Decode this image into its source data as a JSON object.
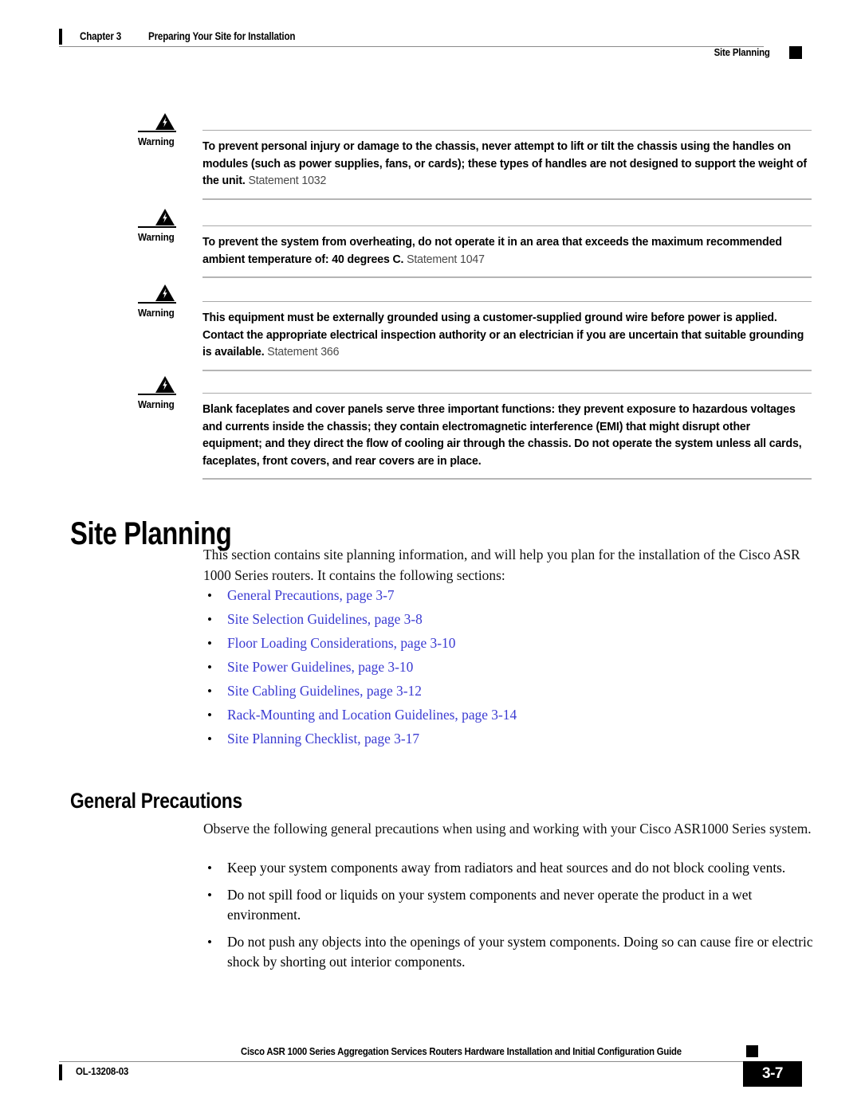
{
  "header": {
    "chapter": "Chapter 3",
    "chapter_title": "Preparing Your Site for Installation",
    "section": "Site Planning"
  },
  "warnings": [
    {
      "label": "Warning",
      "icon": "warning-triangle-lightning-icon",
      "text": "To prevent personal injury or damage to the chassis, never attempt to lift or tilt the chassis using the handles on modules (such as power supplies, fans, or cards); these types of handles are not designed to support the weight of the unit.",
      "statement": "Statement 1032"
    },
    {
      "label": "Warning",
      "icon": "warning-triangle-lightning-icon",
      "text": "To prevent the system from overheating, do not operate it in an area that exceeds the maximum recommended ambient temperature of: 40 degrees C.",
      "statement": "Statement 1047"
    },
    {
      "label": "Warning",
      "icon": "warning-triangle-lightning-icon",
      "text": "This equipment must be externally grounded using a customer-supplied ground wire before power is applied. Contact the appropriate electrical inspection authority or an electrician if you are uncertain that suitable grounding is available.",
      "statement": "Statement 366"
    },
    {
      "label": "Warning",
      "icon": "warning-triangle-lightning-icon",
      "text": "Blank faceplates and cover panels serve three important functions: they prevent exposure to hazardous voltages and currents inside the chassis; they contain electromagnetic interference (EMI) that might disrupt other equipment; and they direct the flow of cooling air through the chassis. Do not operate the system unless all cards, faceplates, front covers, and rear covers are in place.",
      "statement": ""
    }
  ],
  "site_planning": {
    "heading": "Site Planning",
    "intro": "This section contains site planning information, and will help you plan for the installation of the Cisco ASR 1000 Series routers. It contains the following sections:",
    "links": [
      "General Precautions, page 3-7",
      "Site Selection Guidelines, page 3-8",
      "Floor Loading Considerations, page 3-10",
      "Site Power Guidelines, page 3-10",
      "Site Cabling Guidelines, page 3-12",
      "Rack-Mounting and Location Guidelines, page 3-14",
      "Site Planning Checklist, page 3-17"
    ]
  },
  "general_precautions": {
    "heading": "General Precautions",
    "intro": "Observe the following general precautions when using and working with your Cisco ASR1000 Series system.",
    "items": [
      "Keep your system components away from radiators and heat sources and do not block cooling vents.",
      "Do not spill food or liquids on your system components and never operate the product in a wet environment.",
      "Do not push any objects into the openings of your system components. Doing so can cause fire or electric shock by shorting out interior components."
    ]
  },
  "footer": {
    "title": "Cisco ASR 1000 Series Aggregation Services Routers Hardware Installation and Initial Configuration Guide",
    "doc_id": "OL-13208-03",
    "page_number": "3-7"
  },
  "colors": {
    "link": "#3b3bd2",
    "rule": "#8a8a8a",
    "accent": "#000000"
  }
}
